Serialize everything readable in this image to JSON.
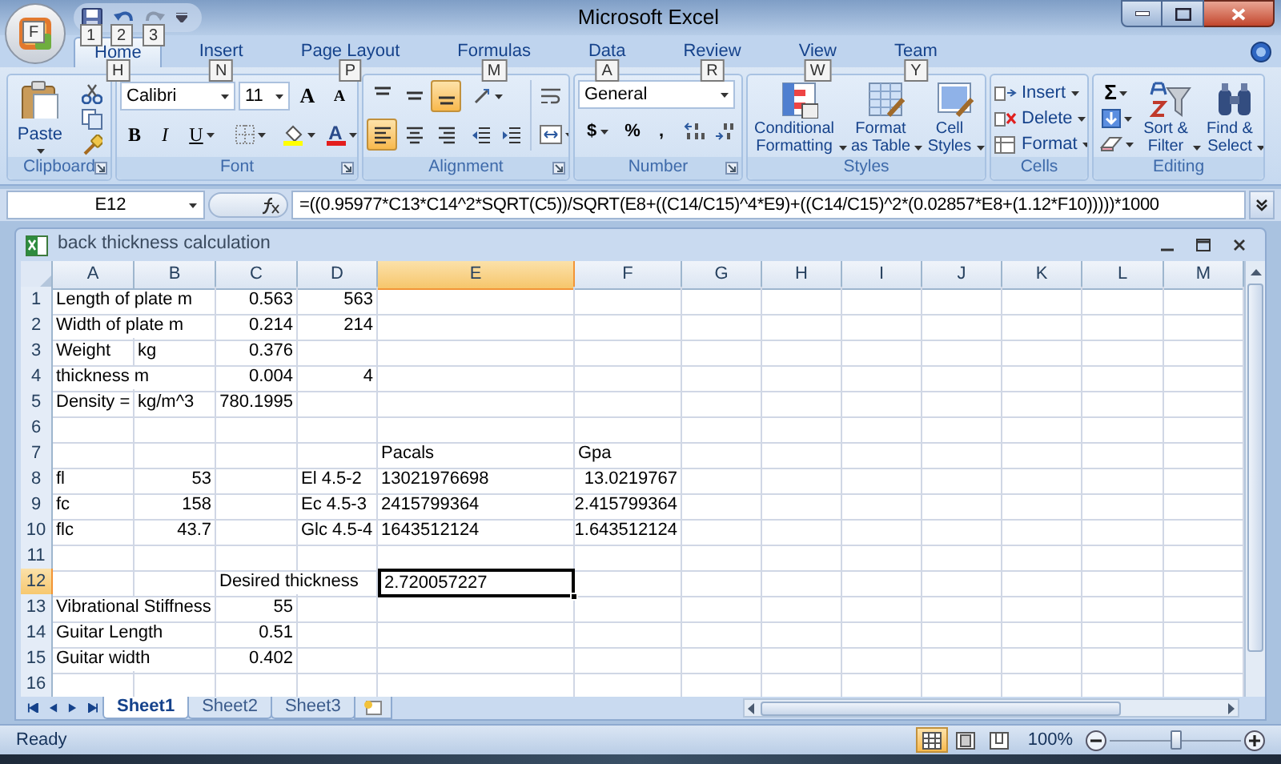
{
  "window": {
    "title": "Microsoft Excel",
    "office_keytip": "F",
    "quick_access_keytips": [
      "1",
      "2",
      "3"
    ]
  },
  "tabs": [
    {
      "label": "Home",
      "keytip": "H",
      "selected": true
    },
    {
      "label": "Insert",
      "keytip": "N",
      "selected": false
    },
    {
      "label": "Page Layout",
      "keytip": "P",
      "selected": false
    },
    {
      "label": "Formulas",
      "keytip": "M",
      "selected": false
    },
    {
      "label": "Data",
      "keytip": "A",
      "selected": false
    },
    {
      "label": "Review",
      "keytip": "R",
      "selected": false
    },
    {
      "label": "View",
      "keytip": "W",
      "selected": false
    },
    {
      "label": "Team",
      "keytip": "Y",
      "selected": false
    }
  ],
  "ribbon": {
    "clipboard": {
      "label": "Clipboard",
      "paste": "Paste"
    },
    "font": {
      "label": "Font",
      "font_name": "Calibri",
      "font_size": "11",
      "grow": "A",
      "shrink": "A",
      "bold": "B",
      "italic": "I",
      "underline": "U",
      "font_color": "A"
    },
    "alignment": {
      "label": "Alignment",
      "vertical": [
        {
          "selected": false
        },
        {
          "selected": false
        },
        {
          "selected": true
        }
      ],
      "horizontal": [
        {
          "selected": true
        },
        {
          "selected": false
        },
        {
          "selected": false
        }
      ]
    },
    "number": {
      "label": "Number",
      "format": "General",
      "currency": "$",
      "percent": "%",
      "comma": ","
    },
    "styles": {
      "label": "Styles",
      "buttons": [
        "Conditional Formatting",
        "Format as Table",
        "Cell Styles"
      ]
    },
    "cells": {
      "label": "Cells",
      "buttons": [
        "Insert",
        "Delete",
        "Format"
      ]
    },
    "editing": {
      "label": "Editing",
      "sum": "Σ",
      "buttons": [
        "Sort & Filter",
        "Find & Select"
      ]
    }
  },
  "formula_bar": {
    "name_box": "E12",
    "formula": "=((0.95977*C13*C14^2*SQRT(C5))/SQRT(E8+((C14/C15)^4*E9)+((C14/C15)^2*(0.02857*E8+(1.12*F10)))))*1000"
  },
  "workbook": {
    "title": "back thickness calculation",
    "columns": [
      {
        "label": "A",
        "selected": false
      },
      {
        "label": "B",
        "selected": false
      },
      {
        "label": "C",
        "selected": false
      },
      {
        "label": "D",
        "selected": false
      },
      {
        "label": "E",
        "selected": true
      },
      {
        "label": "F",
        "selected": false
      },
      {
        "label": "G",
        "selected": false
      },
      {
        "label": "H",
        "selected": false
      },
      {
        "label": "I",
        "selected": false
      },
      {
        "label": "J",
        "selected": false
      },
      {
        "label": "K",
        "selected": false
      },
      {
        "label": "L",
        "selected": false
      },
      {
        "label": "M",
        "selected": false
      }
    ],
    "rows": [
      {
        "number": "1",
        "selected": false,
        "cells": {
          "A": {
            "text": "Length of plate m",
            "kind": "text"
          },
          "C": {
            "text": "0.563",
            "kind": "number"
          },
          "D": {
            "text": "563",
            "kind": "number"
          }
        }
      },
      {
        "number": "2",
        "selected": false,
        "cells": {
          "A": {
            "text": "Width of plate m",
            "kind": "text"
          },
          "C": {
            "text": "0.214",
            "kind": "number"
          },
          "D": {
            "text": "214",
            "kind": "number"
          }
        }
      },
      {
        "number": "3",
        "selected": false,
        "cells": {
          "A": {
            "text": "Weight",
            "kind": "text"
          },
          "B": {
            "text": "kg",
            "kind": "text"
          },
          "C": {
            "text": "0.376",
            "kind": "number"
          }
        }
      },
      {
        "number": "4",
        "selected": false,
        "cells": {
          "A": {
            "text": "thickness m",
            "kind": "text"
          },
          "C": {
            "text": "0.004",
            "kind": "number"
          },
          "D": {
            "text": "4",
            "kind": "number"
          }
        }
      },
      {
        "number": "5",
        "selected": false,
        "cells": {
          "A": {
            "text": "Density =",
            "kind": "text"
          },
          "B": {
            "text": "kg/m^3",
            "kind": "text"
          },
          "C": {
            "text": "780.1995",
            "kind": "number"
          }
        }
      },
      {
        "number": "6",
        "selected": false,
        "cells": {}
      },
      {
        "number": "7",
        "selected": false,
        "cells": {
          "E": {
            "text": "Pacals",
            "kind": "text"
          },
          "F": {
            "text": "Gpa",
            "kind": "text"
          }
        }
      },
      {
        "number": "8",
        "selected": false,
        "cells": {
          "A": {
            "text": "fl",
            "kind": "text"
          },
          "B": {
            "text": "53",
            "kind": "number"
          },
          "D": {
            "text": "El 4.5-2",
            "kind": "text"
          },
          "E": {
            "text": "13021976698",
            "kind": "text"
          },
          "F": {
            "text": "13.0219767",
            "kind": "number"
          }
        }
      },
      {
        "number": "9",
        "selected": false,
        "cells": {
          "A": {
            "text": "fc",
            "kind": "text"
          },
          "B": {
            "text": "158",
            "kind": "number"
          },
          "D": {
            "text": "Ec 4.5-3",
            "kind": "text"
          },
          "E": {
            "text": "2415799364",
            "kind": "text"
          },
          "F": {
            "text": "2.415799364",
            "kind": "number"
          }
        }
      },
      {
        "number": "10",
        "selected": false,
        "cells": {
          "A": {
            "text": "flc",
            "kind": "text"
          },
          "B": {
            "text": "43.7",
            "kind": "number"
          },
          "D": {
            "text": "Glc 4.5-4",
            "kind": "text"
          },
          "E": {
            "text": "1643512124",
            "kind": "text"
          },
          "F": {
            "text": "1.643512124",
            "kind": "number"
          }
        }
      },
      {
        "number": "11",
        "selected": false,
        "cells": {}
      },
      {
        "number": "12",
        "selected": true,
        "cells": {
          "C": {
            "text": "Desired thickness",
            "kind": "text"
          },
          "E": {
            "text": "2.720057227",
            "kind": "text"
          }
        }
      },
      {
        "number": "13",
        "selected": false,
        "cells": {
          "A": {
            "text": "Vibrational Stiffness",
            "kind": "text"
          },
          "C": {
            "text": "55",
            "kind": "number"
          }
        }
      },
      {
        "number": "14",
        "selected": false,
        "cells": {
          "A": {
            "text": "Guitar Length",
            "kind": "text"
          },
          "C": {
            "text": "0.51",
            "kind": "number"
          }
        }
      },
      {
        "number": "15",
        "selected": false,
        "cells": {
          "A": {
            "text": "Guitar width",
            "kind": "text"
          },
          "C": {
            "text": "0.402",
            "kind": "number"
          }
        }
      },
      {
        "number": "16",
        "selected": false,
        "cells": {}
      }
    ]
  },
  "sheet_tabs": [
    {
      "label": "Sheet1",
      "selected": true
    },
    {
      "label": "Sheet2",
      "selected": false
    },
    {
      "label": "Sheet3",
      "selected": false
    }
  ],
  "status_bar": {
    "text": "Ready",
    "views": [
      {
        "selected": true
      },
      {
        "selected": false
      },
      {
        "selected": false
      }
    ],
    "zoom": "100%",
    "zoom_slider": {
      "level": 0.5
    }
  }
}
